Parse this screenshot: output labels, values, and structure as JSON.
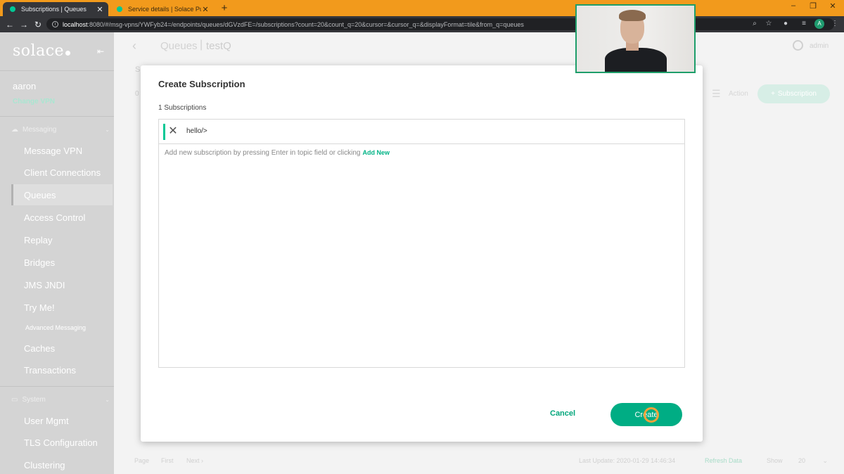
{
  "browser": {
    "tabs": [
      {
        "title": "Subscriptions | Queues",
        "active": true
      },
      {
        "title": "Service details | Solace PubSub+",
        "active": false
      }
    ],
    "new_tab": "+",
    "url_host": "localhost",
    "url_rest": ":8080/#/msg-vpns/YWFyb24=/endpoints/queues/dGVzdFE=/subscriptions?count=20&count_q=20&cursor=&cursor_q=&displayFormat=tile&from_q=queues",
    "profile_initial": "A"
  },
  "sidebar": {
    "logo": "solace",
    "user": "aaron",
    "change_vpn": "Change VPN",
    "sections": [
      {
        "label": "Messaging"
      },
      {
        "label": "System"
      }
    ],
    "items": [
      {
        "label": "Message VPN"
      },
      {
        "label": "Client Connections"
      },
      {
        "label": "Queues"
      },
      {
        "label": "Access Control"
      },
      {
        "label": "Replay"
      },
      {
        "label": "Bridges"
      },
      {
        "label": "JMS JNDI"
      },
      {
        "label": "Try Me!"
      },
      {
        "label": "Advanced Messaging"
      },
      {
        "label": "Caches"
      },
      {
        "label": "Transactions"
      },
      {
        "label": "User Mgmt"
      },
      {
        "label": "TLS Configuration"
      },
      {
        "label": "Clustering"
      }
    ]
  },
  "page": {
    "breadcrumb_parent": "Queues",
    "breadcrumb_current": "testQ",
    "user_label": "admin",
    "tab_initial": "S",
    "count_initial": "0",
    "action_label": "Action",
    "add_subscription_label": "Subscription",
    "footer": {
      "page_label": "Page",
      "first_label": "First",
      "next_label": "Next",
      "last_update": "Last Update: 2020-01-29 14:46:34",
      "refresh": "Refresh Data",
      "show_label": "Show",
      "show_value": "20"
    }
  },
  "modal": {
    "title": "Create Subscription",
    "count_text": "1 Subscriptions",
    "subscriptions": [
      "hello/>"
    ],
    "hint": "Add new subscription by pressing Enter in topic field or clicking",
    "add_new": "Add New",
    "cancel": "Cancel",
    "create": "Create"
  },
  "colors": {
    "accent": "#00ad84",
    "chrome_tabbar": "#f29a1c",
    "chrome_dark": "#35363a"
  }
}
